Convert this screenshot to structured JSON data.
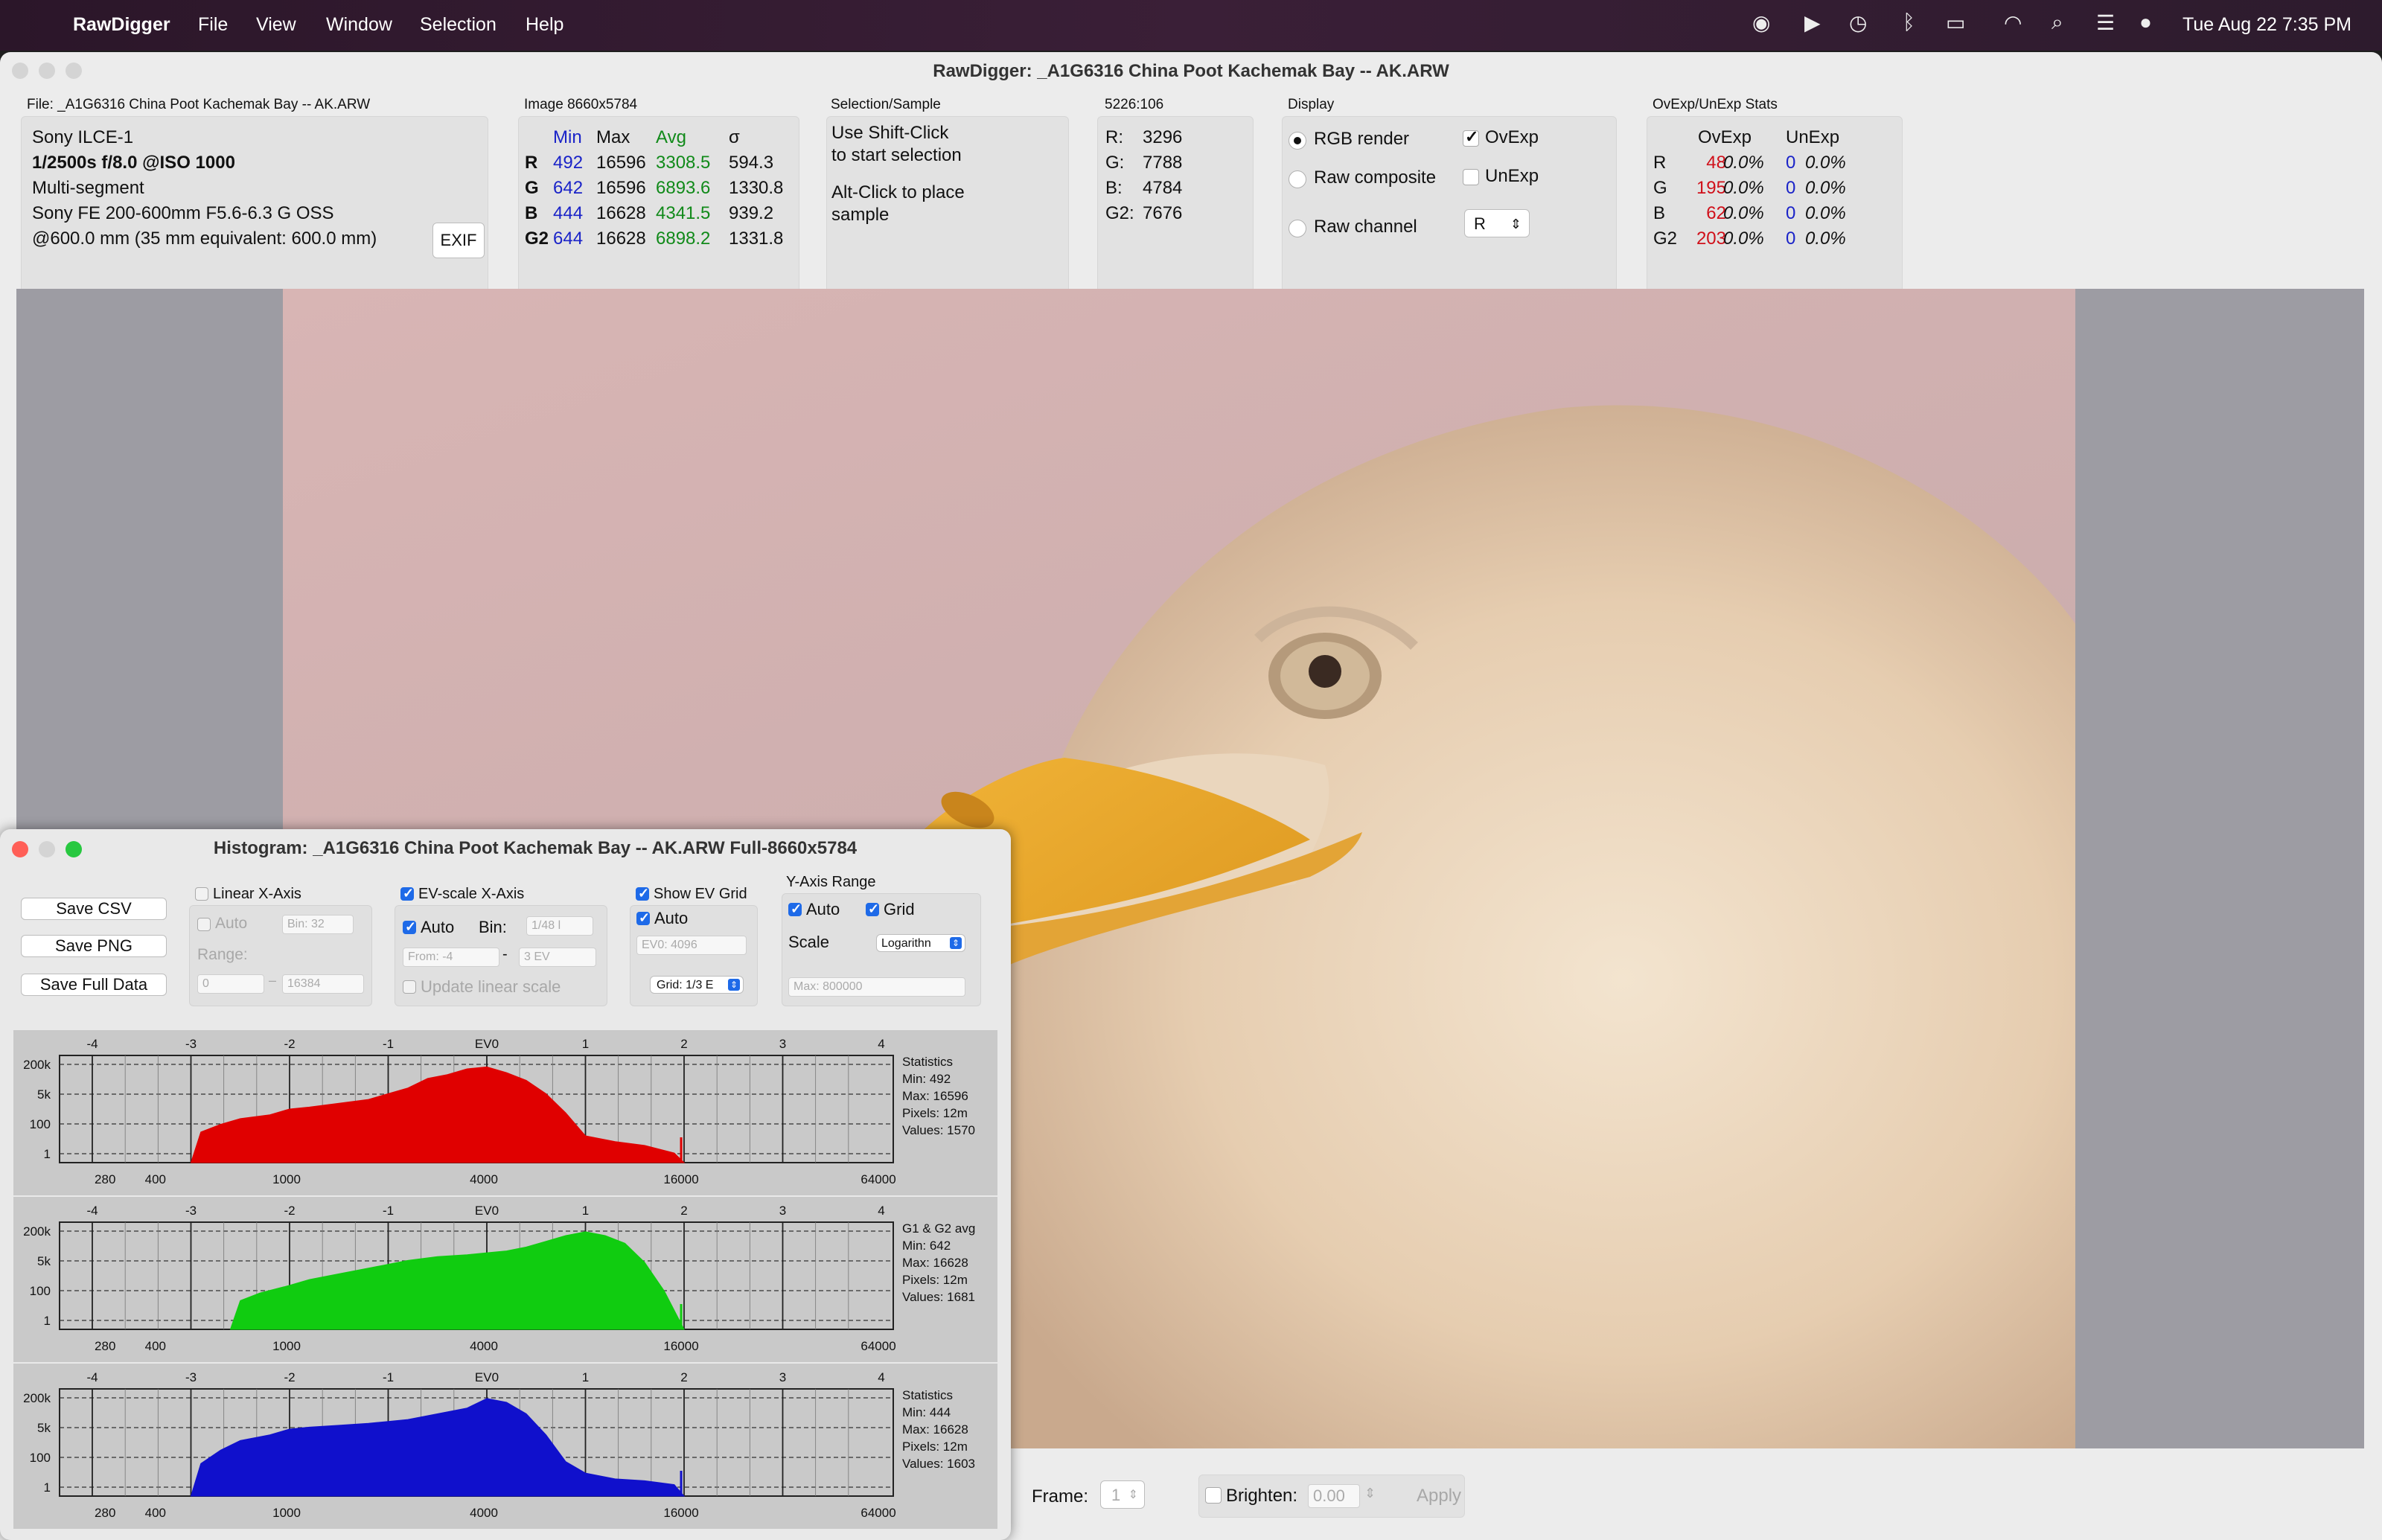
{
  "menubar": {
    "app_name": "RawDigger",
    "items": [
      "File",
      "View",
      "Window",
      "Selection",
      "Help"
    ],
    "clock": "Tue Aug 22  7:35 PM"
  },
  "main_window": {
    "title": "RawDigger: _A1G6316 China Poot Kachemak Bay -- AK.ARW",
    "file_panel": {
      "label": "File: _A1G6316 China Poot Kachemak Bay -- AK.ARW",
      "camera": "Sony ILCE-1",
      "exposure": "1/2500s f/8.0 @ISO 1000",
      "segment": "Multi-segment",
      "lens": "Sony FE 200-600mm F5.6-6.3 G OSS",
      "focal": "@600.0 mm (35 mm equivalent: 600.0 mm)",
      "exif_button": "EXIF"
    },
    "image_panel": {
      "label": "Image 8660x5784",
      "headers": [
        "Min",
        "Max",
        "Avg",
        "σ"
      ],
      "rows": [
        {
          "ch": "R",
          "min": "492",
          "max": "16596",
          "avg": "3308.5",
          "sigma": "594.3"
        },
        {
          "ch": "G",
          "min": "642",
          "max": "16596",
          "avg": "6893.6",
          "sigma": "1330.8"
        },
        {
          "ch": "B",
          "min": "444",
          "max": "16628",
          "avg": "4341.5",
          "sigma": "939.2"
        },
        {
          "ch": "G2",
          "min": "644",
          "max": "16628",
          "avg": "6898.2",
          "sigma": "1331.8"
        }
      ]
    },
    "selection_panel": {
      "label": "Selection/Sample",
      "line1": "Use Shift-Click",
      "line2": "to start selection",
      "line3": "Alt-Click to place",
      "line4": "sample"
    },
    "coord_panel": {
      "label": "5226:106",
      "rows": [
        {
          "ch": "R:",
          "val": "3296"
        },
        {
          "ch": "G:",
          "val": "7788"
        },
        {
          "ch": "B:",
          "val": "4784"
        },
        {
          "ch": "G2:",
          "val": "7676"
        }
      ]
    },
    "display_panel": {
      "label": "Display",
      "rgb_render": "RGB render",
      "raw_composite": "Raw composite",
      "raw_channel": "Raw channel",
      "ovexp": "OvExp",
      "unexp": "UnExp",
      "channel_select": "R"
    },
    "stats_panel": {
      "label": "OvExp/UnExp Stats",
      "headers": [
        "OvExp",
        "UnExp"
      ],
      "rows": [
        {
          "ch": "R",
          "ov": "48",
          "ovp": "0.0%",
          "un": "0",
          "unp": "0.0%"
        },
        {
          "ch": "G",
          "ov": "195",
          "ovp": "0.0%",
          "un": "0",
          "unp": "0.0%"
        },
        {
          "ch": "B",
          "ov": "62",
          "ovp": "0.0%",
          "un": "0",
          "unp": "0.0%"
        },
        {
          "ch": "G2",
          "ov": "203",
          "ovp": "0.0%",
          "un": "0",
          "unp": "0.0%"
        }
      ]
    },
    "bottom": {
      "frame_label": "Frame:",
      "frame_value": "1",
      "brighten_label": "Brighten:",
      "brighten_value": "0.00",
      "apply": "Apply"
    }
  },
  "histogram_window": {
    "title": "Histogram: _A1G6316 China Poot Kachemak Bay -- AK.ARW Full-8660x5784",
    "buttons": {
      "save_csv": "Save CSV",
      "save_png": "Save PNG",
      "save_full": "Save Full Data"
    },
    "linear": {
      "label": "Linear X-Axis",
      "auto": "Auto",
      "bin": "Bin: 32",
      "range": "Range:",
      "from": "0",
      "to": "16384"
    },
    "ev": {
      "label": "EV-scale X-Axis",
      "auto": "Auto",
      "bin_label": "Bin:",
      "bin": "1/48 l",
      "from": "From: -4",
      "to": "3 EV",
      "update": "Update linear scale"
    },
    "evgrid": {
      "label": "Show EV Grid",
      "auto": "Auto",
      "ev0": "EV0: 4096",
      "grid": "Grid: 1/3 E"
    },
    "yaxis": {
      "label": "Y-Axis Range",
      "auto": "Auto",
      "grid": "Grid",
      "scale_label": "Scale",
      "scale": "Logarithn",
      "max": "Max: 800000"
    },
    "ev_ticks": [
      "-4",
      "-3",
      "-2",
      "-1",
      "EV0",
      "1",
      "2",
      "3",
      "4"
    ],
    "y_ticks": [
      "200k",
      "5k",
      "100",
      "1"
    ],
    "x_ticks": [
      "280",
      "400",
      "1000",
      "4000",
      "16000",
      "64000"
    ]
  },
  "chart_data": [
    {
      "type": "area",
      "color": "#e00000",
      "stats": {
        "title": "Statistics",
        "min": "Min: 492",
        "max": "Max: 16596",
        "pixels": "Pixels: 12m",
        "values": "Values: 1570"
      },
      "x": [
        -3.0,
        -2.9,
        -2.7,
        -2.5,
        -2.2,
        -2.0,
        -1.8,
        -1.5,
        -1.2,
        -1.0,
        -0.8,
        -0.6,
        -0.4,
        -0.2,
        0.0,
        0.2,
        0.4,
        0.6,
        0.8,
        1.0,
        1.3,
        1.6,
        1.9,
        2.0
      ],
      "y_log10": [
        0,
        1.6,
        2.0,
        2.3,
        2.5,
        2.8,
        2.9,
        3.1,
        3.3,
        3.6,
        3.9,
        4.4,
        4.6,
        4.9,
        5.0,
        4.7,
        4.3,
        3.6,
        2.6,
        1.4,
        1.1,
        0.9,
        0.5,
        0
      ]
    },
    {
      "type": "area",
      "color": "#10cc10",
      "stats": {
        "title": "G1 & G2 avg",
        "min": "Min: 642",
        "max": "Max: 16628",
        "pixels": "Pixels: 12m",
        "values": "Values: 1681"
      },
      "x": [
        -2.6,
        -2.5,
        -2.3,
        -2.0,
        -1.8,
        -1.5,
        -1.2,
        -1.0,
        -0.8,
        -0.5,
        -0.2,
        0.0,
        0.2,
        0.4,
        0.6,
        0.8,
        1.0,
        1.2,
        1.4,
        1.6,
        1.8,
        2.0
      ],
      "y_log10": [
        0,
        1.5,
        1.9,
        2.3,
        2.6,
        2.9,
        3.2,
        3.4,
        3.6,
        3.8,
        3.9,
        4.0,
        4.1,
        4.3,
        4.6,
        4.9,
        5.1,
        4.9,
        4.5,
        3.5,
        2.0,
        0
      ]
    },
    {
      "type": "area",
      "color": "#1010cc",
      "stats": {
        "title": "Statistics",
        "min": "Min: 444",
        "max": "Max: 16628",
        "pixels": "Pixels: 12m",
        "values": "Values: 1603"
      },
      "x": [
        -3.0,
        -2.9,
        -2.7,
        -2.5,
        -2.2,
        -2.0,
        -1.8,
        -1.5,
        -1.2,
        -1.0,
        -0.8,
        -0.6,
        -0.4,
        -0.2,
        0.0,
        0.2,
        0.4,
        0.6,
        0.8,
        1.0,
        1.3,
        1.6,
        1.9,
        2.0
      ],
      "y_log10": [
        0,
        1.7,
        2.4,
        2.9,
        3.2,
        3.5,
        3.6,
        3.7,
        3.8,
        3.9,
        4.0,
        4.2,
        4.4,
        4.6,
        5.1,
        4.9,
        4.3,
        3.2,
        1.8,
        1.2,
        0.9,
        0.8,
        0.6,
        0
      ]
    }
  ]
}
